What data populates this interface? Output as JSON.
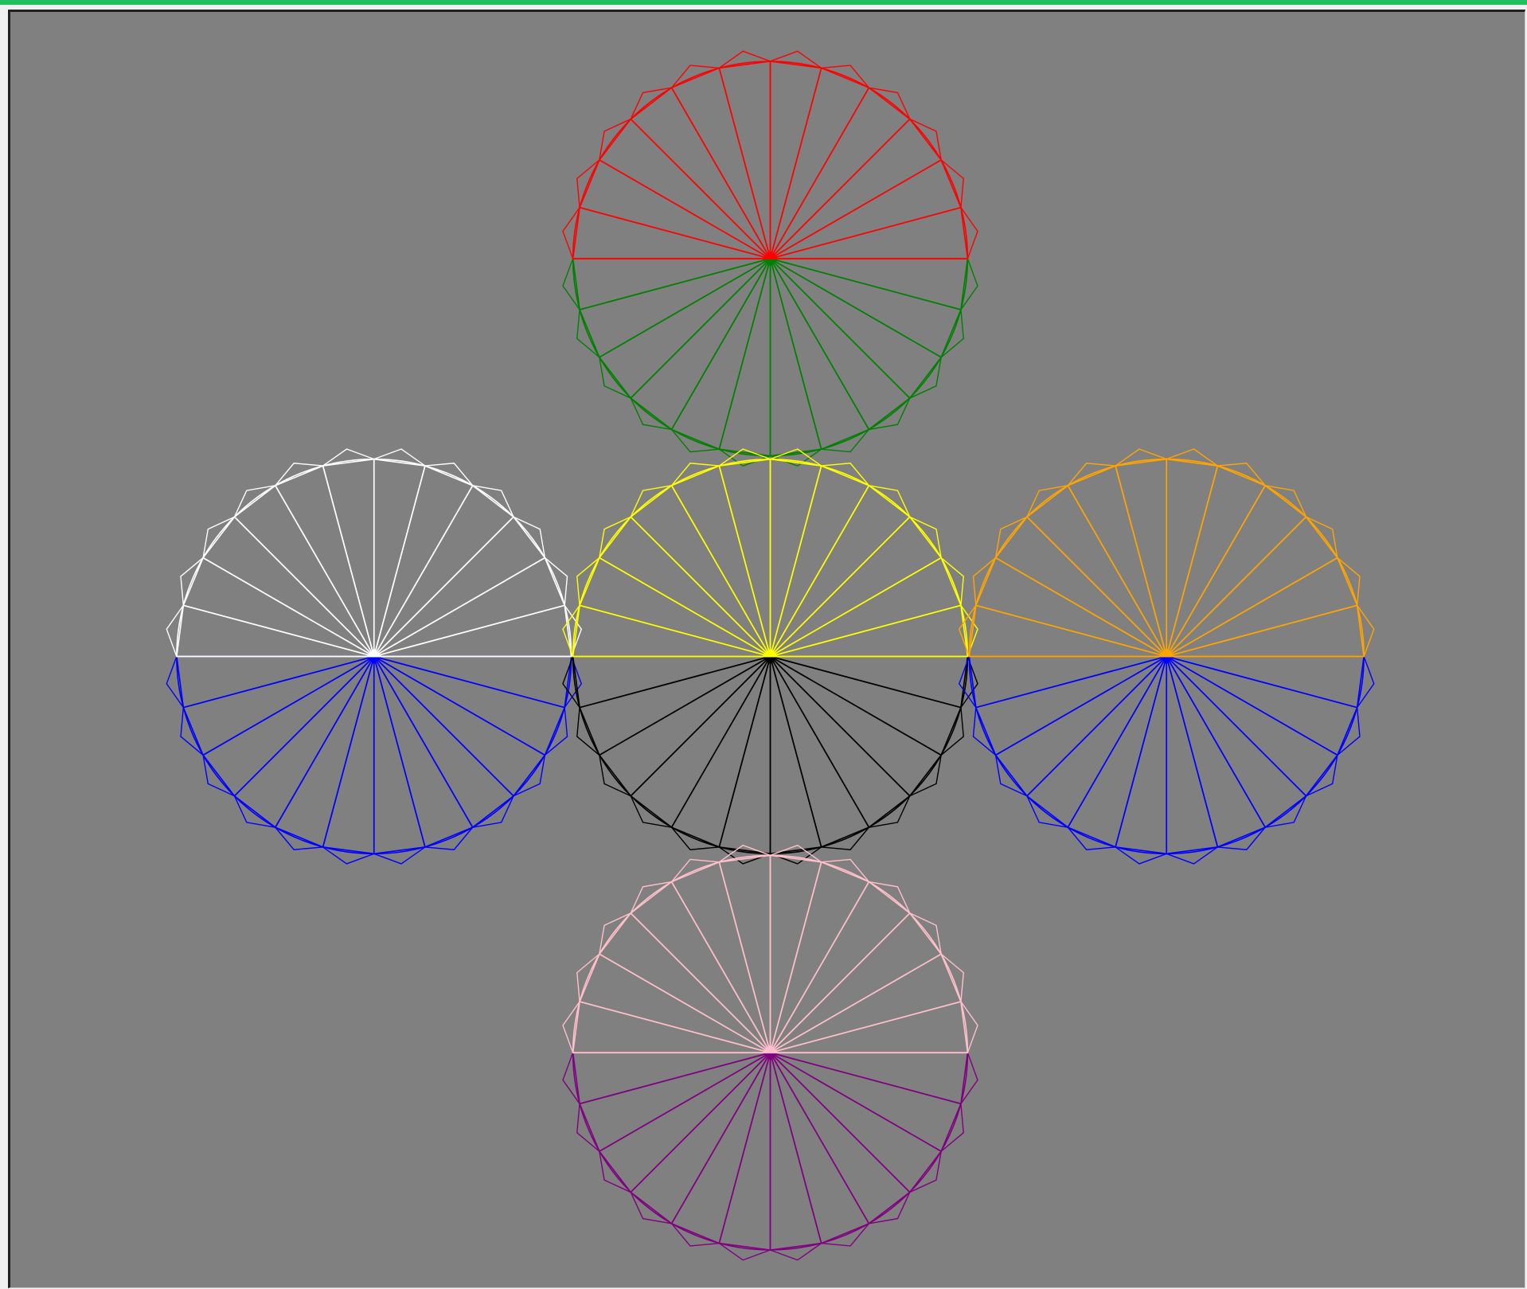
{
  "window": {
    "accent_color": "#20c060",
    "canvas_background": "#808080"
  },
  "drawing": {
    "shape": "half-circle fan of triangles",
    "spokes_per_half": 12,
    "wheels": [
      {
        "name": "top",
        "upper_half_color": "#ff0000",
        "lower_half_color": "#008000"
      },
      {
        "name": "left",
        "upper_half_color": "#ffffff",
        "lower_half_color": "#0000ff"
      },
      {
        "name": "center",
        "upper_half_color": "#ffff00",
        "lower_half_color": "#000000"
      },
      {
        "name": "right",
        "upper_half_color": "#ffa500",
        "lower_half_color": "#0000ff"
      },
      {
        "name": "bottom",
        "upper_half_color": "#ffc0cb",
        "lower_half_color": "#800080"
      }
    ]
  }
}
